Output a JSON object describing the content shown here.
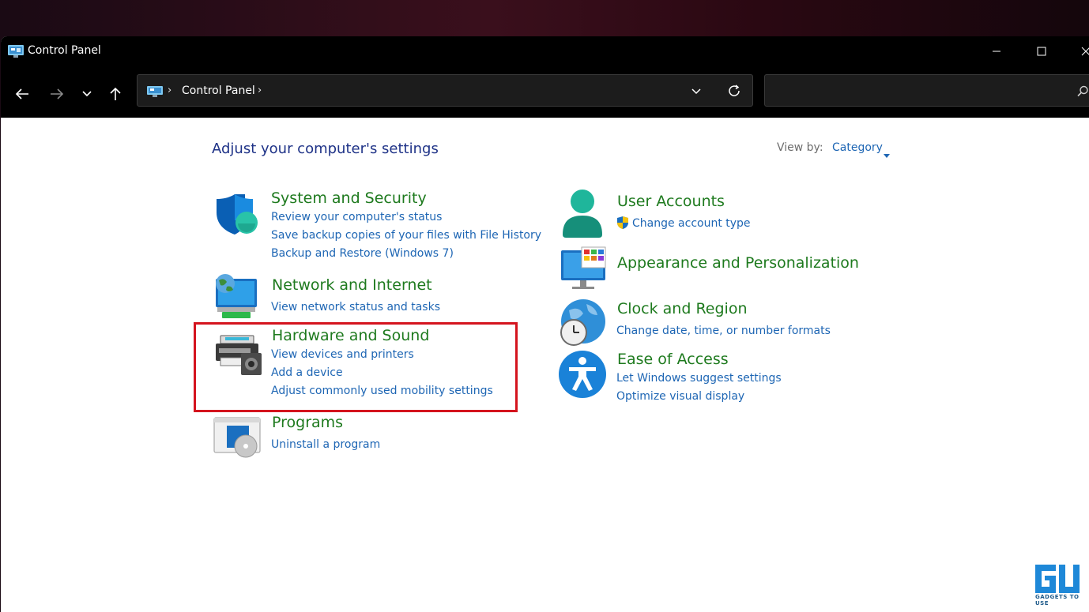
{
  "window": {
    "title": "Control Panel"
  },
  "address_bar": {
    "crumb": "Control Panel",
    "separator": "›"
  },
  "search": {
    "placeholder": ""
  },
  "content": {
    "heading": "Adjust your computer's settings",
    "view_by_label": "View by:",
    "view_by_value": "Category"
  },
  "categories": {
    "system_security": {
      "title": "System and Security",
      "links": [
        "Review your computer's status",
        "Save backup copies of your files with File History",
        "Backup and Restore (Windows 7)"
      ]
    },
    "network": {
      "title": "Network and Internet",
      "links": [
        "View network status and tasks"
      ]
    },
    "hardware": {
      "title": "Hardware and Sound",
      "links": [
        "View devices and printers",
        "Add a device",
        "Adjust commonly used mobility settings"
      ]
    },
    "programs": {
      "title": "Programs",
      "links": [
        "Uninstall a program"
      ]
    },
    "user_accounts": {
      "title": "User Accounts",
      "links": [
        "Change account type"
      ]
    },
    "appearance": {
      "title": "Appearance and Personalization",
      "links": []
    },
    "clock": {
      "title": "Clock and Region",
      "links": [
        "Change date, time, or number formats"
      ]
    },
    "ease": {
      "title": "Ease of Access",
      "links": [
        "Let Windows suggest settings",
        "Optimize visual display"
      ]
    }
  },
  "icons": {
    "app": "control-panel-icon",
    "back": "back-arrow-icon",
    "forward": "forward-arrow-icon",
    "recent": "chevron-down-icon",
    "up": "up-arrow-icon",
    "refresh": "refresh-icon",
    "search": "search-icon"
  },
  "watermark": {
    "text": "GADGETS TO USE"
  },
  "colors": {
    "category_title": "#1e7a1e",
    "link": "#1e66b4",
    "heading": "#1e3287",
    "highlight": "#d4141e"
  }
}
